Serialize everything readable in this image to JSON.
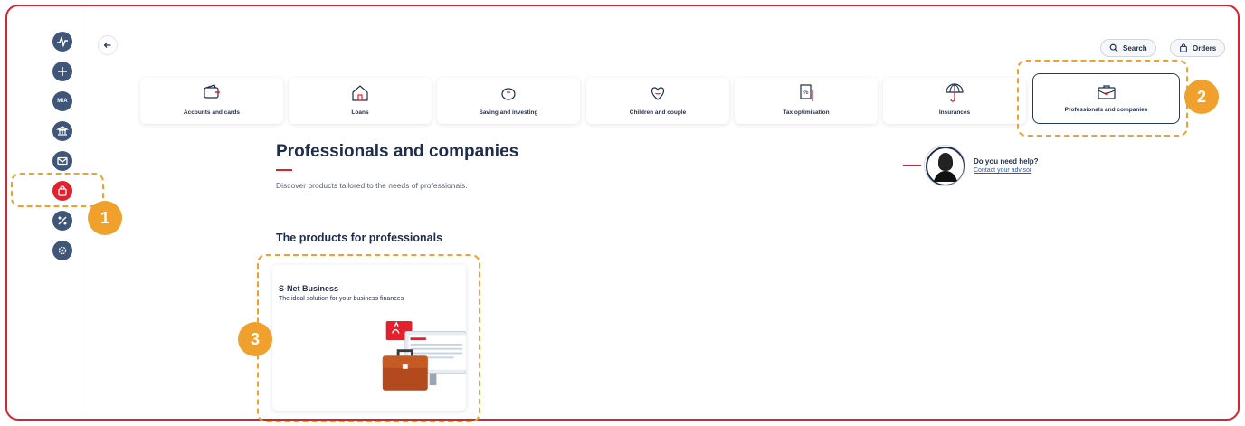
{
  "header": {
    "search_label": "Search",
    "orders_label": "Orders"
  },
  "sidebar": {
    "items": [
      {
        "name": "activity-icon"
      },
      {
        "name": "plus-icon"
      },
      {
        "name": "mia-icon",
        "label": "MIA"
      },
      {
        "name": "bank-icon"
      },
      {
        "name": "mail-icon"
      },
      {
        "name": "shopping-bag-icon",
        "active": true
      },
      {
        "name": "percent-icon"
      },
      {
        "name": "gear-icon"
      }
    ]
  },
  "categories": [
    {
      "label": "Accounts and cards",
      "icon": "wallet-icon"
    },
    {
      "label": "Loans",
      "icon": "house-icon"
    },
    {
      "label": "Saving and investing",
      "icon": "piggy-bank-icon"
    },
    {
      "label": "Children and couple",
      "icon": "heart-icon"
    },
    {
      "label": "Tax optimisation",
      "icon": "tax-document-icon"
    },
    {
      "label": "Insurances",
      "icon": "umbrella-icon"
    },
    {
      "label": "Professionals and companies",
      "icon": "briefcase-icon",
      "selected": true
    }
  ],
  "main": {
    "title": "Professionals and companies",
    "subtitle": "Discover products tailored to the needs of professionals.",
    "section_title": "The products for professionals"
  },
  "help": {
    "title": "Do you need help?",
    "link": "Contact your advisor"
  },
  "products": [
    {
      "name": "S-Net Business",
      "description": "The ideal solution for your business finances"
    }
  ],
  "annotations": {
    "badge1": "1",
    "badge2": "2",
    "badge3": "3"
  },
  "colors": {
    "accent_red": "#d9232e",
    "navy": "#1f2d4d",
    "annotation_orange": "#f0a12d"
  }
}
